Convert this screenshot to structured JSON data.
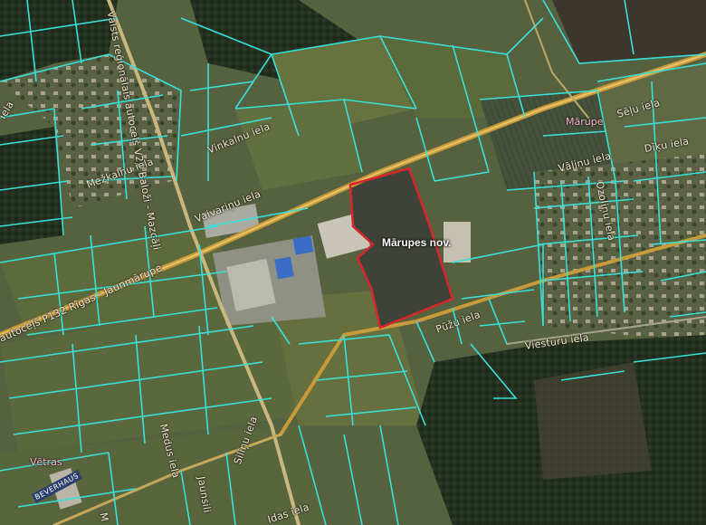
{
  "map": {
    "type": "cadastral-satellite",
    "colors": {
      "parcel_lines": "#38e0d9",
      "highlight_outline": "#d9262b",
      "road": "#e8b23a",
      "field_dark": "#3a4a2e",
      "forest": "#24301f"
    }
  },
  "highlight": {
    "label": "Mārupes nov."
  },
  "towns": {
    "marupe": "Mārupe",
    "vetras": "Vētras"
  },
  "roads": {
    "highway_main": "autoceļš P132 Rīgas - Jaunmārupe",
    "highway_north": "Valsts reģionālais autoceļš V22 Baloži - Mazcāļi",
    "vinkalnu": "Vinkalnu iela",
    "mezkalnu": "Mežkalnu iela",
    "vaivarinu": "Vaivariņu iela",
    "selju": "Sēļu iela",
    "diku": "Dīķu iela",
    "valinu": "Vāliņu iela",
    "ozolini": "Ozoliņu iela",
    "puzu": "Pūžu iela",
    "viesturu": "Viesturu iela",
    "medu": "Medus iela",
    "silinu": "Siliņu iela",
    "jaunsili": "Jaunsili",
    "idas": "Idas iela",
    "edge_left": "iela",
    "edge_bottom": "M"
  },
  "signage": {
    "store": "BEVERHAUS"
  }
}
